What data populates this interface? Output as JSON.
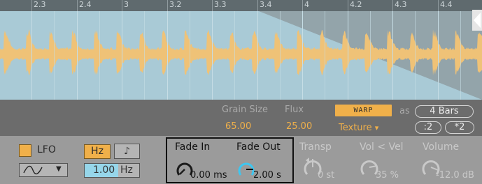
{
  "ruler": {
    "ticks": [
      "2.3",
      "2.4",
      "3",
      "3.2",
      "3.3",
      "3.4",
      "4",
      "4.2",
      "4.3",
      "4.4"
    ]
  },
  "warp": {
    "grain_size_label": "Grain Size",
    "grain_size_value": "65.00",
    "flux_label": "Flux",
    "flux_value": "25.00",
    "warp_button": "WARP",
    "mode_value": "Texture",
    "mode_arrow": "▾",
    "as_label": "as",
    "length_value": "4 Bars",
    "halve_button": ":2",
    "double_button": "*2"
  },
  "lfo": {
    "label": "LFO",
    "hz_button": "Hz",
    "note_button": "♪",
    "rate_value": "1.00",
    "rate_unit": "Hz",
    "shape_arrow": "▼"
  },
  "fades": {
    "fade_in_label": "Fade In",
    "fade_in_value": "0.00 ms",
    "fade_in_level": 0.0,
    "fade_out_label": "Fade Out",
    "fade_out_value": "2.00 s",
    "fade_out_level": 0.5
  },
  "dials": {
    "transp_label": "Transp",
    "transp_value": "0 st",
    "vol_vel_label": "Vol < Vel",
    "vol_vel_value": "35 %",
    "volume_label": "Volume",
    "volume_value": "-12.0 dB"
  },
  "colors": {
    "accent": "#f0b04a",
    "wave_bg": "#a9cad6",
    "waveform": "#efc277",
    "highlight_knob": "#3ec6f0"
  }
}
